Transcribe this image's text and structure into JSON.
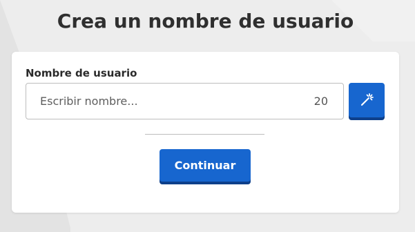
{
  "page": {
    "title": "Crea un nombre de usuario"
  },
  "form": {
    "label": "Nombre de usuario",
    "input_value": "",
    "input_placeholder": "Escribir nombre...",
    "char_count": "20",
    "generate_icon": "magic-wand-icon",
    "continue_label": "Continuar"
  },
  "colors": {
    "background": "#ededed",
    "card": "#ffffff",
    "primary": "#1766cf",
    "primary_shadow": "#0d3f8a"
  }
}
